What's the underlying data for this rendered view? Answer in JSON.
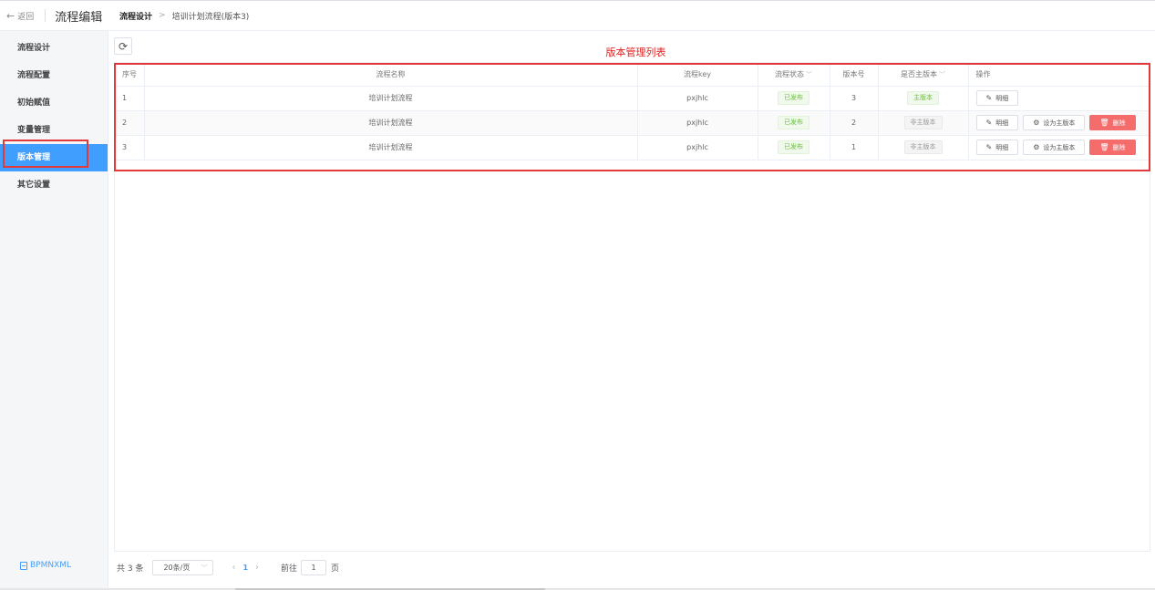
{
  "sidebar": {
    "back_label": "返回",
    "title": "流程编辑",
    "items": [
      {
        "label": "流程设计"
      },
      {
        "label": "流程配置"
      },
      {
        "label": "初始赋值"
      },
      {
        "label": "变量管理"
      },
      {
        "label": "版本管理"
      },
      {
        "label": "其它设置"
      }
    ],
    "active_index": 4,
    "footer_link": "BPMNXML"
  },
  "breadcrumb": {
    "root": "流程设计",
    "separator": ">",
    "current": "培训计划流程(版本3)"
  },
  "table_title": "版本管理列表",
  "table": {
    "headers": [
      "序号",
      "流程名称",
      "流程key",
      "流程状态",
      "版本号",
      "是否主版本",
      "操作"
    ],
    "rows": [
      {
        "index": "1",
        "name": "培训计划流程",
        "key": "pxjhlc",
        "status": "已发布",
        "version": "3",
        "main": "主版本",
        "is_main": true
      },
      {
        "index": "2",
        "name": "培训计划流程",
        "key": "pxjhlc",
        "status": "已发布",
        "version": "2",
        "main": "非主版本",
        "is_main": false
      },
      {
        "index": "3",
        "name": "培训计划流程",
        "key": "pxjhlc",
        "status": "已发布",
        "version": "1",
        "main": "非主版本",
        "is_main": false
      }
    ],
    "actions": {
      "detail": "明细",
      "set_main": "设为主版本",
      "delete": "删除"
    }
  },
  "pagination": {
    "total_text": "共 3 条",
    "page_size": "20条/页",
    "current_page": "1",
    "goto_label": "前往",
    "goto_value": "1",
    "page_suffix": "页"
  },
  "colors": {
    "accent": "#409eff",
    "highlight": "#e23a3a",
    "danger": "#f56c6c",
    "success": "#67c23a"
  }
}
